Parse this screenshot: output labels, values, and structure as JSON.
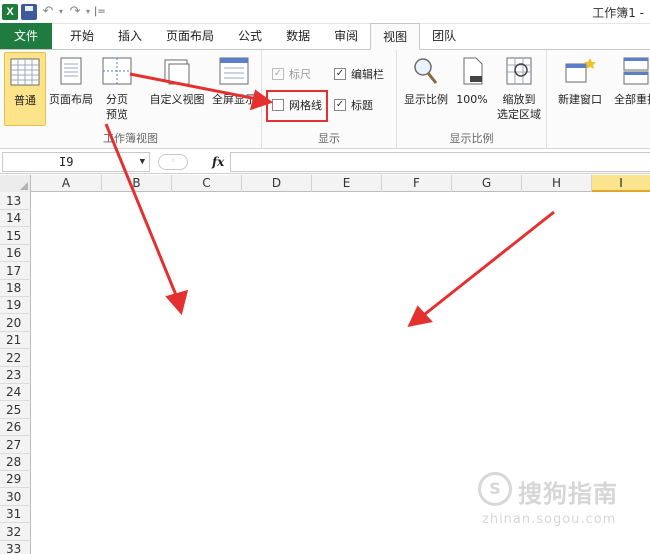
{
  "window": {
    "title": "工作簿1 -"
  },
  "quick_access": {
    "logo": "X",
    "separator": "|",
    "customize": "="
  },
  "tabs": [
    {
      "label": "文件",
      "kind": "file"
    },
    {
      "label": "开始"
    },
    {
      "label": "插入"
    },
    {
      "label": "页面布局"
    },
    {
      "label": "公式"
    },
    {
      "label": "数据"
    },
    {
      "label": "审阅"
    },
    {
      "label": "视图",
      "active": true
    },
    {
      "label": "团队"
    }
  ],
  "ribbon": {
    "workbook_views": {
      "group_label": "工作簿视图",
      "normal": "普通",
      "page_layout": "页面布局",
      "page_break_1": "分页",
      "page_break_2": "预览",
      "custom_views": "自定义视图",
      "full_screen": "全屏显示"
    },
    "show": {
      "group_label": "显示",
      "ruler": {
        "label": "标尺",
        "checked": true,
        "disabled": true
      },
      "formula_bar": {
        "label": "编辑栏",
        "checked": true
      },
      "gridlines": {
        "label": "网格线",
        "checked": false
      },
      "headings": {
        "label": "标题",
        "checked": true
      }
    },
    "zoom": {
      "group_label": "显示比例",
      "zoom": "显示比例",
      "zoom100": "100%",
      "zoom_sel_1": "缩放到",
      "zoom_sel_2": "选定区域"
    },
    "window": {
      "new_window": "新建窗口",
      "arrange_all": "全部重排"
    }
  },
  "formula_bar": {
    "name_box": "I9",
    "fx": "fx",
    "formula": ""
  },
  "grid": {
    "columns": [
      "A",
      "B",
      "C",
      "D",
      "E",
      "F",
      "G",
      "H",
      "I"
    ],
    "selected_column": "I",
    "rows": [
      "13",
      "14",
      "15",
      "16",
      "17",
      "18",
      "19",
      "20",
      "21",
      "22",
      "23",
      "24",
      "25",
      "26",
      "27",
      "28",
      "29",
      "30",
      "31",
      "32",
      "33"
    ]
  },
  "watermark": {
    "logo": "S",
    "text": "搜狗指南",
    "url": "zhinan.sogou.com"
  },
  "colors": {
    "file_tab": "#1f7c41",
    "selected": "#fde48a",
    "annotation": "#e53030"
  }
}
